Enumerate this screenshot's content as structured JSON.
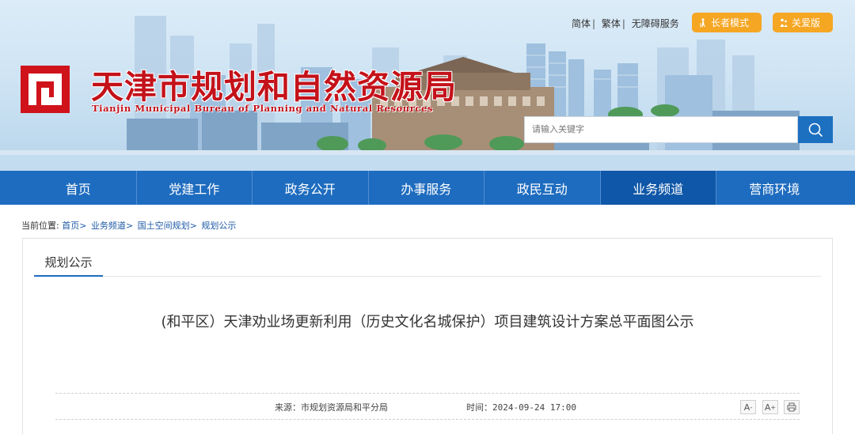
{
  "header": {
    "title": "天津市规划和自然资源局",
    "subtitle": "Tianjin Municipal Bureau of Planning and Natural Resources",
    "top_links": [
      "简体",
      "繁体",
      "无障碍服务"
    ],
    "elder_mode_label": "长者模式",
    "care_mode_label": "关爱版",
    "search": {
      "placeholder": "请输入关键字",
      "value": ""
    },
    "icons": [
      "logo-mark",
      "elder-icon",
      "care-icon",
      "search-icon"
    ],
    "colors": {
      "brand_red": "#c4121a",
      "nav_blue": "#1e6cbf",
      "accent_orange": "#f5a623"
    }
  },
  "nav": {
    "items": [
      "首页",
      "党建工作",
      "政务公开",
      "办事服务",
      "政民互动",
      "业务频道",
      "营商环境"
    ],
    "active": "业务频道"
  },
  "breadcrumb": {
    "prefix": "当前位置:",
    "items": [
      "首页",
      "业务频道",
      "国土空间规划",
      "规划公示"
    ]
  },
  "content": {
    "tab_label": "规划公示",
    "article_title": "(和平区）天津劝业场更新利用（历史文化名城保护）项目建筑设计方案总平面图公示",
    "source": "来源：市规划资源局和平分局",
    "time": "时间：2024-09-24 17:00",
    "tools": {
      "decrease": "A",
      "increase": "A",
      "print": "print-icon"
    }
  }
}
